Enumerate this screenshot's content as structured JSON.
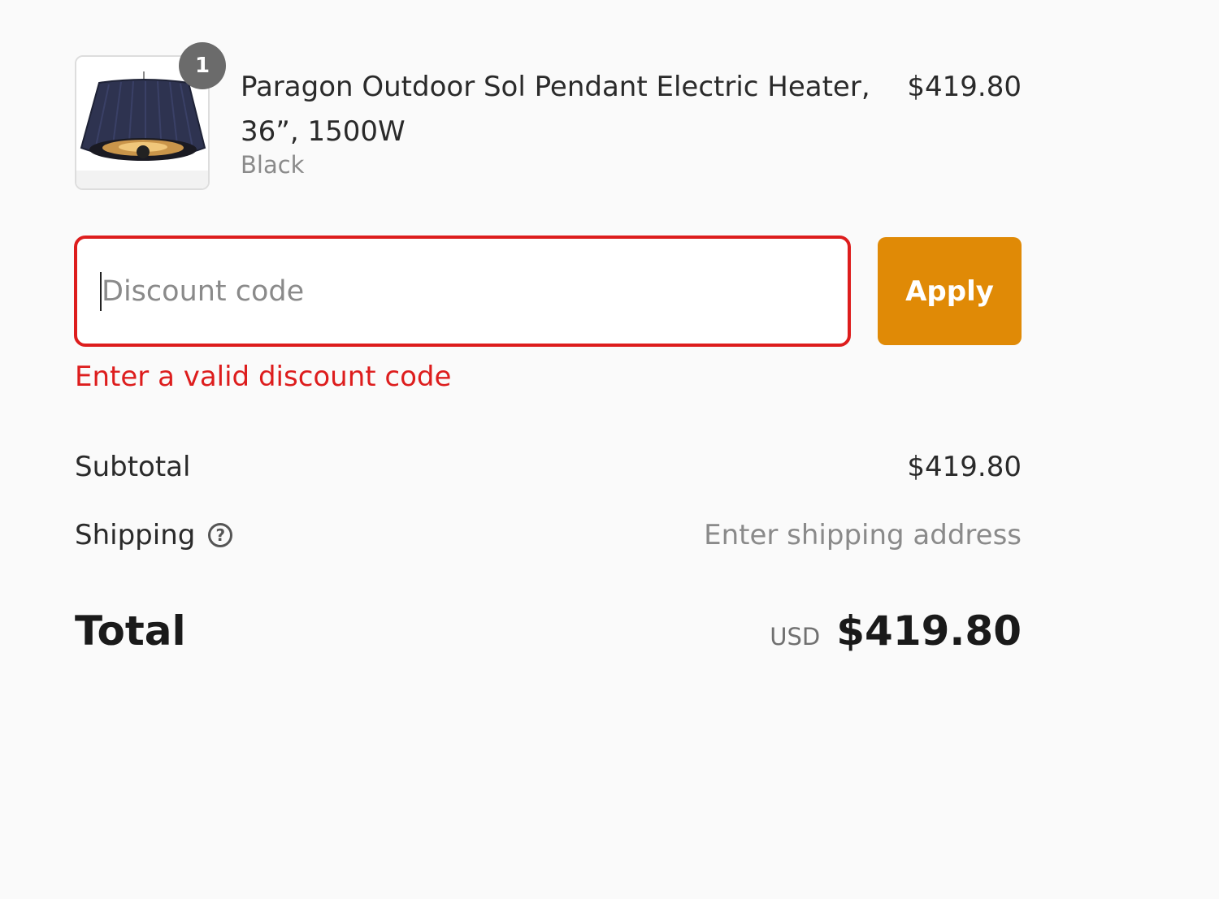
{
  "line_item": {
    "quantity": "1",
    "name": "Paragon Outdoor Sol Pendant Electric Heater, 36”, 1500W",
    "variant": "Black",
    "price": "$419.80",
    "image_icon": "pendant-heater-image"
  },
  "discount": {
    "placeholder": "Discount code",
    "value": "",
    "apply_label": "Apply",
    "error": "Enter a valid discount code",
    "error_color": "#dd1d1d",
    "button_color": "#e08a06"
  },
  "summary": {
    "subtotal_label": "Subtotal",
    "subtotal_value": "$419.80",
    "shipping_label": "Shipping",
    "shipping_value": "Enter shipping address",
    "shipping_help_icon": "question-circle-icon",
    "total_label": "Total",
    "currency": "USD",
    "total_value": "$419.80"
  }
}
